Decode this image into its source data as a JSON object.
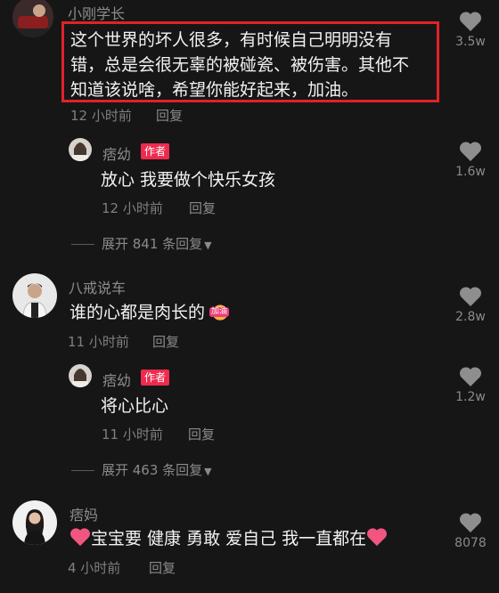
{
  "comments": [
    {
      "user": "小刚学长",
      "lines": [
        "这个世界的坏人很多，有时候自己明明没有",
        "错，总是会很无辜的被碰瓷、被伤害。其他不",
        "知道该说啥，希望你能好起来，加油。"
      ],
      "time": "12 小时前",
      "reply_label": "回复",
      "likes": "3.5w",
      "replies": [
        {
          "user": "痞幼",
          "badge": "作者",
          "text": "放心 我要做个快乐女孩",
          "time": "12 小时前",
          "reply_label": "回复",
          "likes": "1.6w"
        }
      ],
      "expand_label": "展开 841 条回复"
    },
    {
      "user": "八戒说车",
      "text": "谁的心都是肉长的",
      "sticker_text": "加油",
      "time": "11 小时前",
      "reply_label": "回复",
      "likes": "2.8w",
      "replies": [
        {
          "user": "痞幼",
          "badge": "作者",
          "text": "将心比心",
          "time": "11 小时前",
          "reply_label": "回复",
          "likes": "1.2w"
        }
      ],
      "expand_label": "展开 463 条回复"
    },
    {
      "user": "痞妈",
      "text": "宝宝要 健康 勇敢 爱自己 我一直都在",
      "time": "4 小时前",
      "reply_label": "回复",
      "likes": "8078"
    }
  ],
  "colors": {
    "highlight": "#e2202a",
    "badge": "#ee2b4f",
    "heart_emoji": "#f0567f"
  }
}
